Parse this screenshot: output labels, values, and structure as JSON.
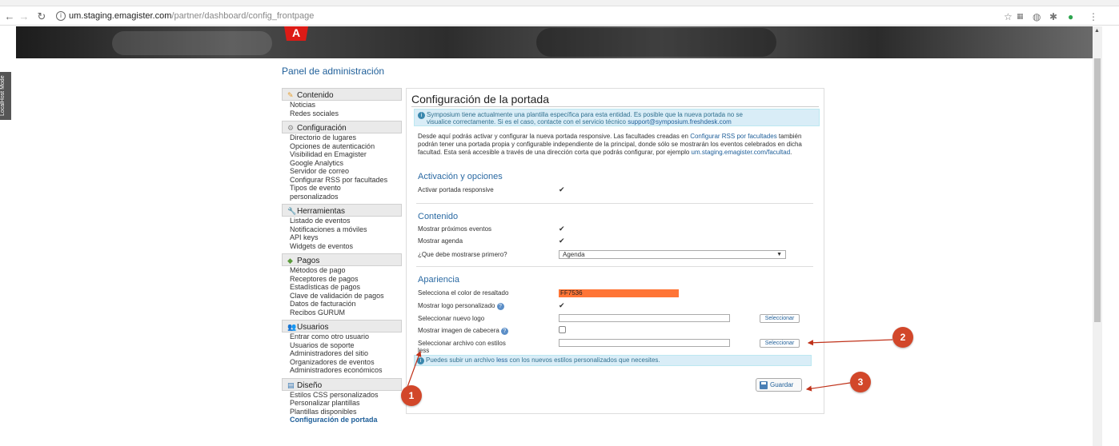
{
  "browser": {
    "url_host": "um.staging.emagister.com",
    "url_path": "/partner/dashboard/config_frontpage",
    "info_icon": "i"
  },
  "banner": {
    "logo_letter": "A"
  },
  "localhost_tab": "LocalHost Mode",
  "panel_title": "Panel de administración",
  "sidebar": {
    "contenido": {
      "title": "Contenido",
      "items": [
        "Noticias",
        "Redes sociales"
      ]
    },
    "configuracion": {
      "title": "Configuración",
      "items": [
        "Directorio de lugares",
        "Opciones de autenticación",
        "Visibilidad en Emagister",
        "Google Analytics",
        "Servidor de correo",
        "Configurar RSS por facultades",
        "Tipos de evento",
        "personalizados"
      ]
    },
    "herramientas": {
      "title": "Herramientas",
      "items": [
        "Listado de eventos",
        "Notificaciones a móviles",
        "API keys",
        "Widgets de eventos"
      ]
    },
    "pagos": {
      "title": "Pagos",
      "items": [
        "Métodos de pago",
        "Receptores de pagos",
        "Estadísticas de pagos",
        "Clave de validación de pagos",
        "Datos de facturación",
        "Recibos GURUM"
      ]
    },
    "usuarios": {
      "title": "Usuarios",
      "items": [
        "Entrar como otro usuario",
        "Usuarios de soporte",
        "Administradores del sitio",
        "Organizadores de eventos",
        "Administradores económicos"
      ]
    },
    "diseno": {
      "title": "Diseño",
      "items": [
        "Estilos CSS personalizados",
        "Personalizar plantillas",
        "Plantillas disponibles",
        "Configuración de portada"
      ]
    }
  },
  "main": {
    "title": "Configuración de la portada",
    "alert_line1": "Symposium tiene actualmente una plantilla específica para esta entidad. Es posible que la nueva portada no se",
    "alert_line2_prefix": "visualice correctamente. Si es el caso, contacte con el servicio técnico ",
    "alert_email": "support@symposium.freshdesk.com",
    "intro_1": "Desde aquí podrás activar y configurar la nueva portada responsive. Las facultades creadas en ",
    "intro_link1": "Configurar RSS por facultades",
    "intro_2": " también podrán tener una portada propia y configurable independiente de la principal, donde sólo se mostrarán los eventos celebrados en dicha facultad. Esta será accesible a través de una dirección corta que podrás configurar, por ejemplo ",
    "intro_link2": "um.staging.emagister.com/facultad",
    "intro_3": ".",
    "sec_activacion": "Activación y opciones",
    "activar_label": "Activar portada responsive",
    "sec_contenido": "Contenido",
    "proximos_label": "Mostrar próximos eventos",
    "agenda_label": "Mostrar agenda",
    "primero_label": "¿Que debe mostrarse primero?",
    "primero_value": "Agenda",
    "sec_apariencia": "Apariencia",
    "color_label": "Selecciona el color de resaltado",
    "color_value": "FF7536",
    "logo_custom_label": "Mostrar logo personalizado",
    "new_logo_label": "Seleccionar nuevo logo",
    "select_button": "Seleccionar",
    "cabecera_label": "Mostrar imagen de cabecera",
    "styles_label_1": "Seleccionar archivo con estilos",
    "styles_label_2": "less",
    "info_prefix": "Puedes subir un archivo ",
    "info_link": "less",
    "info_suffix": " con los nuevos estilos personalizados que necesites.",
    "save_button": "Guardar",
    "checkmark": "✔",
    "help_q": "?",
    "caret": "▼"
  },
  "annotations": {
    "m1": "1",
    "m2": "2",
    "m3": "3",
    "accent": "#d2472a"
  }
}
